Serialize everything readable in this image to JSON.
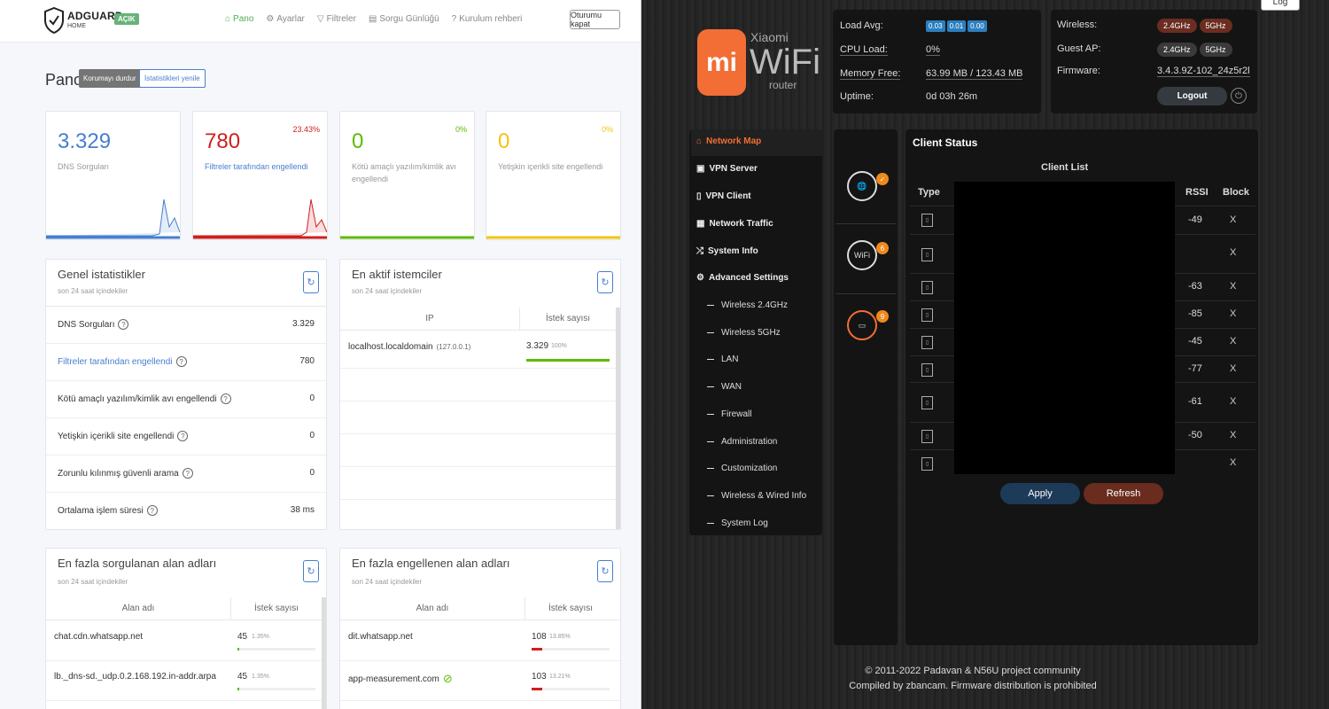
{
  "adguard": {
    "brand": "ADGUARD",
    "brand_sub": "HOME",
    "status_badge": "AÇIK",
    "nav": [
      "Pano",
      "Ayarlar",
      "Filtreler",
      "Sorgu Günlüğü",
      "Kurulum rehberi"
    ],
    "logout": "Oturumu kapat",
    "page_title": "Pano",
    "btn_disable": "Korumayı durdur",
    "btn_refresh_stats": "İstatistikleri yenile",
    "stats": [
      {
        "value": "3.329",
        "label": "DNS Sorguları",
        "pct": "",
        "color": "#467fcf"
      },
      {
        "value": "780",
        "label": "Filtreler tarafından engellendi",
        "pct": "23.43%",
        "color": "#cd201f"
      },
      {
        "value": "0",
        "label": "Kötü amaçlı yazılım/kimlik avı engellendi",
        "pct": "0%",
        "color": "#5eba00"
      },
      {
        "value": "0",
        "label": "Yetişkin içerikli site engellendi",
        "pct": "0%",
        "color": "#f1c40f"
      }
    ],
    "general": {
      "title": "Genel istatistikler",
      "subtitle": "son 24 saat içindekiler",
      "rows": [
        {
          "k": "DNS Sorguları",
          "v": "3.329"
        },
        {
          "k": "Filtreler tarafından engellendi",
          "v": "780"
        },
        {
          "k": "Kötü amaçlı yazılım/kimlik avı engellendi",
          "v": "0"
        },
        {
          "k": "Yetişkin içerikli site engellendi",
          "v": "0"
        },
        {
          "k": "Zorunlu kılınmış güvenli arama",
          "v": "0"
        },
        {
          "k": "Ortalama işlem süresi",
          "v": "38 ms"
        }
      ]
    },
    "clients": {
      "title": "En aktif istemciler",
      "subtitle": "son 24 saat içindekiler",
      "col_ip": "IP",
      "col_count": "İstek sayısı",
      "rows": [
        {
          "name": "localhost.localdomain",
          "ip": "(127.0.0.1)",
          "count": "3.329",
          "pct": "100%",
          "fill": 1.0
        }
      ]
    },
    "top_domains": {
      "title": "En fazla sorgulanan alan adları",
      "subtitle": "son 24 saat içindekiler",
      "col_domain": "Alan adı",
      "col_count": "İstek sayısı",
      "rows": [
        {
          "d": "chat.cdn.whatsapp.net",
          "n": "45",
          "p": "1.35%",
          "fill": 0.0135
        },
        {
          "d": "lb._dns-sd._udp.0.2.168.192.in-addr.arpa",
          "n": "45",
          "p": "1.35%",
          "fill": 0.0135
        }
      ]
    },
    "top_blocked": {
      "title": "En fazla engellenen alan adları",
      "subtitle": "son 24 saat içindekiler",
      "col_domain": "Alan adı",
      "col_count": "İstek sayısı",
      "rows": [
        {
          "d": "dit.whatsapp.net",
          "n": "108",
          "p": "13.85%",
          "fill": 0.1385
        },
        {
          "d": "app-measurement.com",
          "n": "103",
          "p": "13.21%",
          "fill": 0.1321
        }
      ]
    }
  },
  "router": {
    "top_button": "Log",
    "logo_xiaomi": "Xiaomi",
    "logo_wifi": "WiFi",
    "logo_router": "router",
    "load_avg_label": "Load Avg:",
    "load_avg": [
      "0.03",
      "0.01",
      "0.00"
    ],
    "cpu_label": "CPU Load:",
    "cpu_value": "0%",
    "mem_label": "Memory Free:",
    "mem_value": "63.99 MB / 123.43 MB",
    "uptime_label": "Uptime:",
    "uptime_value": "0d 03h 26m",
    "wireless_label": "Wireless:",
    "guest_label": "Guest AP:",
    "bands": [
      "2.4GHz",
      "5GHz"
    ],
    "firmware_label": "Firmware:",
    "firmware_value": "3.4.3.9Z-102_24z5r2l",
    "logout": "Logout",
    "menu": [
      "Network Map",
      "VPN Server",
      "VPN Client",
      "Network Traffic",
      "System Info",
      "Advanced Settings"
    ],
    "submenu": [
      "Wireless 2.4GHz",
      "Wireless 5GHz",
      "LAN",
      "WAN",
      "Firewall",
      "Administration",
      "Customization",
      "Wireless & Wired Info",
      "System Log"
    ],
    "status_badges": [
      "✓",
      "6",
      "9"
    ],
    "client_status_title": "Client Status",
    "client_list_title": "Client List",
    "col_type": "Type",
    "col_rssi": "RSSI",
    "col_block": "Block",
    "clients": [
      {
        "rssi": "-49",
        "block": "X"
      },
      {
        "rssi": "",
        "block": "X"
      },
      {
        "rssi": "-63",
        "block": "X"
      },
      {
        "rssi": "-85",
        "block": "X"
      },
      {
        "rssi": "-45",
        "block": "X"
      },
      {
        "rssi": "-77",
        "block": "X"
      },
      {
        "rssi": "-61",
        "block": "X"
      },
      {
        "rssi": "-50",
        "block": "X"
      },
      {
        "rssi": "",
        "block": "X"
      }
    ],
    "apply": "Apply",
    "refresh": "Refresh",
    "footer1": "© 2011-2022 Padavan & N56U project community",
    "footer2": "Compiled by zbancam. Firmware distribution is prohibited"
  }
}
